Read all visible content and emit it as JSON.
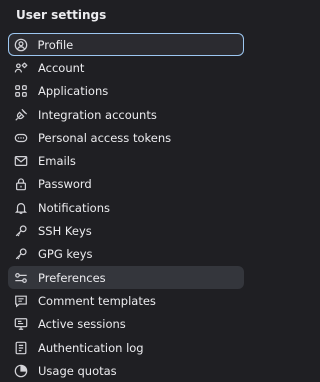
{
  "sidebar": {
    "header": "User settings",
    "active_index": 0,
    "selected_index": 10,
    "items": [
      {
        "label": "Profile",
        "icon": "profile-icon"
      },
      {
        "label": "Account",
        "icon": "account-icon"
      },
      {
        "label": "Applications",
        "icon": "applications-icon"
      },
      {
        "label": "Integration accounts",
        "icon": "integration-icon"
      },
      {
        "label": "Personal access tokens",
        "icon": "token-icon"
      },
      {
        "label": "Emails",
        "icon": "mail-icon"
      },
      {
        "label": "Password",
        "icon": "lock-icon"
      },
      {
        "label": "Notifications",
        "icon": "bell-icon"
      },
      {
        "label": "SSH Keys",
        "icon": "key-icon"
      },
      {
        "label": "GPG keys",
        "icon": "key-icon"
      },
      {
        "label": "Preferences",
        "icon": "preferences-icon"
      },
      {
        "label": "Comment templates",
        "icon": "comment-icon"
      },
      {
        "label": "Active sessions",
        "icon": "monitor-icon"
      },
      {
        "label": "Authentication log",
        "icon": "log-icon"
      },
      {
        "label": "Usage quotas",
        "icon": "quota-icon"
      }
    ]
  }
}
